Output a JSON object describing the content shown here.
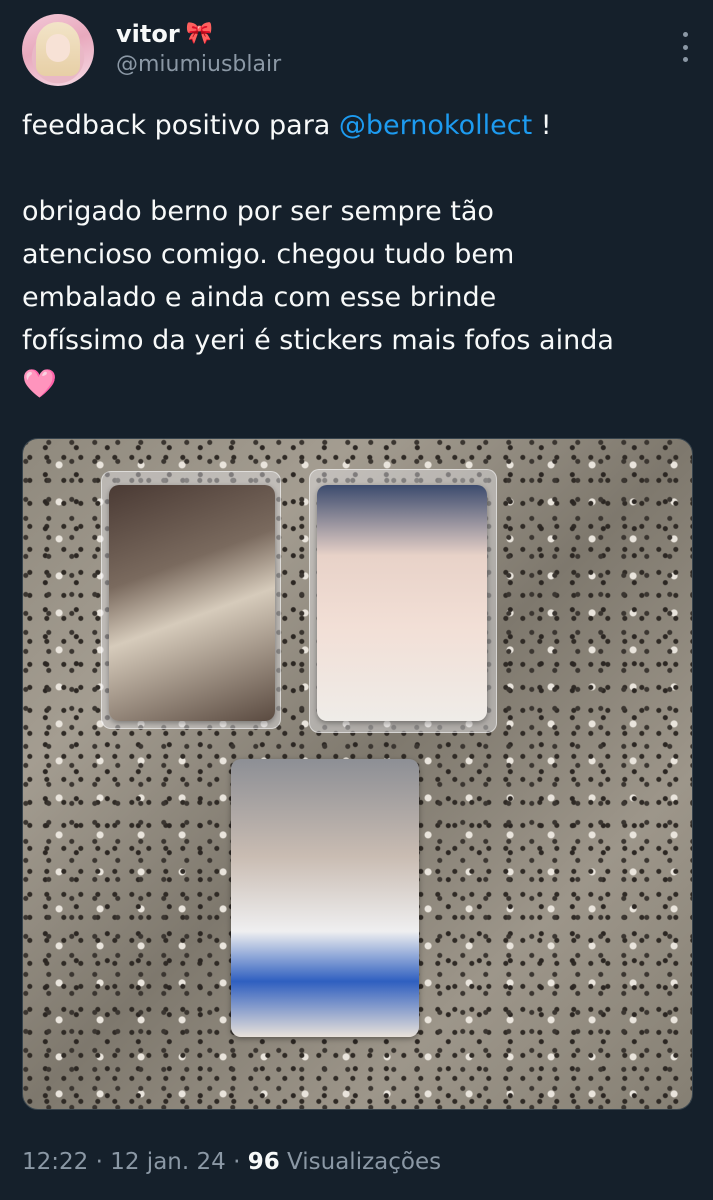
{
  "author": {
    "display_name": "vitor",
    "name_emoji": "🎀",
    "handle": "@miumiusblair"
  },
  "tweet": {
    "line1_prefix": "feedback positivo para ",
    "mention": "@bernokollect",
    "line1_suffix": " !",
    "body_lines": [
      "obrigado berno por ser sempre tão",
      "atencioso comigo. chegou tudo bem",
      "embalado e ainda com esse brinde",
      "fofíssimo da yeri é stickers mais fofos ainda"
    ],
    "emoji": "🩷"
  },
  "meta": {
    "time": "12:22",
    "sep1": " · ",
    "date": "12 jan. 24",
    "sep2": " · ",
    "views_count": "96",
    "views_label": " Visualizações"
  },
  "colors": {
    "background": "#15202b",
    "text": "#f7f9f9",
    "secondary": "#8b98a5",
    "accent": "#1d9bf0"
  },
  "icons": [
    "more-icon"
  ]
}
